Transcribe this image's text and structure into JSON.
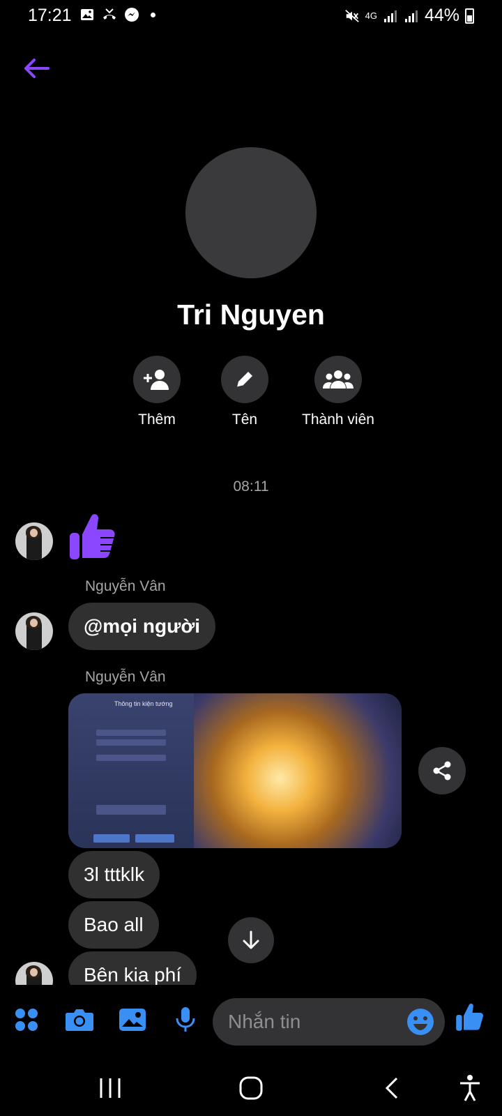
{
  "status_bar": {
    "time": "17:21",
    "network": "4G",
    "battery": "44%"
  },
  "header": {
    "back_icon": "back-arrow-icon"
  },
  "profile": {
    "name": "Tri Nguyen",
    "actions": [
      {
        "label": "Thêm",
        "icon": "add-person-icon"
      },
      {
        "label": "Tên",
        "icon": "pencil-icon"
      },
      {
        "label": "Thành viên",
        "icon": "group-icon"
      }
    ]
  },
  "chat": {
    "timestamp": "08:11",
    "sender_1": "Nguyễn Vân",
    "bubble_mention": "@mọi người",
    "sender_2": "Nguyễn Vân",
    "photo_title": "Thông tin kiện tướng",
    "bubble_1": "3l tttklk",
    "bubble_2": "Bao all",
    "bubble_3": "Bên kia phí"
  },
  "composer": {
    "placeholder": "Nhắn tin"
  },
  "colors": {
    "accent_purple": "#8a47ff",
    "accent_blue": "#3a8ff5",
    "bubble": "#303030",
    "background": "#000000"
  }
}
